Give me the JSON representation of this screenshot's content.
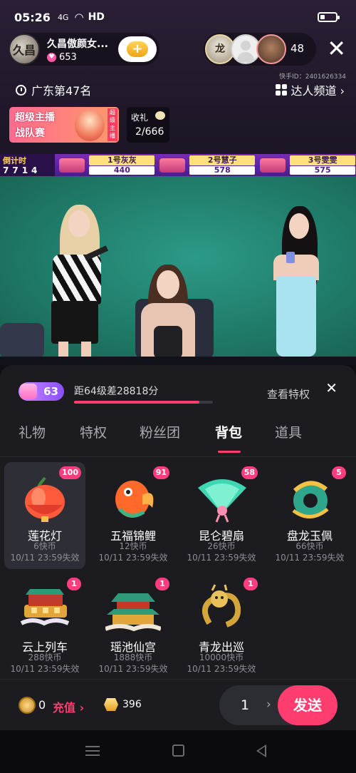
{
  "status_bar": {
    "time": "05:26",
    "signal": "4G",
    "network": "HD"
  },
  "host": {
    "avatar_text": "久昌",
    "name": "久昌傲颜女...",
    "likes": "653"
  },
  "audience": {
    "count": "48",
    "avatars": [
      "vip-user-avatar",
      "default-avatar",
      "user-avatar"
    ]
  },
  "kuaishou_id": "快手ID：2401626334",
  "rank": {
    "label": "广东第47名"
  },
  "channel": {
    "label": "达人频道 ›"
  },
  "event_banner": {
    "line1": "超级主播",
    "line2": "战队赛",
    "tag": "超级主播"
  },
  "gift_goal": {
    "label": "收礼",
    "progress": "2/666"
  },
  "scoreboard": {
    "countdown_label": "倒计时",
    "countdown_value": "7714",
    "teams": [
      {
        "name": "1号灰灰",
        "score": "440"
      },
      {
        "name": "2号慧子",
        "score": "578"
      },
      {
        "name": "3号雯雯",
        "score": "575"
      }
    ]
  },
  "panel": {
    "level_badge": "63",
    "level_progress_text": "距64级差28818分",
    "level_progress_fraction": 0.9,
    "view_privileges": "查看特权",
    "tabs": [
      "礼物",
      "特权",
      "粉丝团",
      "背包",
      "道具"
    ],
    "active_tab_index": 3
  },
  "items": [
    {
      "name": "莲花灯",
      "price": "6快币",
      "expiry": "10/11 23:59失效",
      "count": "100",
      "icon": "lotus-lantern-icon"
    },
    {
      "name": "五福锦鲤",
      "price": "12快币",
      "expiry": "10/11 23:59失效",
      "count": "91",
      "icon": "koi-fish-icon"
    },
    {
      "name": "昆仑碧扇",
      "price": "26快币",
      "expiry": "10/11 23:59失效",
      "count": "58",
      "icon": "jade-fan-icon"
    },
    {
      "name": "盘龙玉佩",
      "price": "66快币",
      "expiry": "10/11 23:59失效",
      "count": "5",
      "icon": "dragon-jade-pendant-icon"
    },
    {
      "name": "云上列车",
      "price": "288快币",
      "expiry": "10/11 23:59失效",
      "count": "1",
      "icon": "cloud-train-icon"
    },
    {
      "name": "瑶池仙宫",
      "price": "1888快币",
      "expiry": "10/11 23:59失效",
      "count": "1",
      "icon": "fairy-palace-icon"
    },
    {
      "name": "青龙出巡",
      "price": "10000快币",
      "expiry": "10/11 23:59失效",
      "count": "1",
      "icon": "azure-dragon-icon"
    }
  ],
  "bottom_bar": {
    "coin_balance": "0",
    "recharge_label": "充值 ›",
    "gold_balance": "396",
    "quantity": "1",
    "quantity_arrow": "›",
    "send_label": "发送"
  },
  "colors": {
    "accent": "#ff3d6e",
    "panel_bg": "#1b1b20",
    "video_bg": "#1f7866"
  }
}
